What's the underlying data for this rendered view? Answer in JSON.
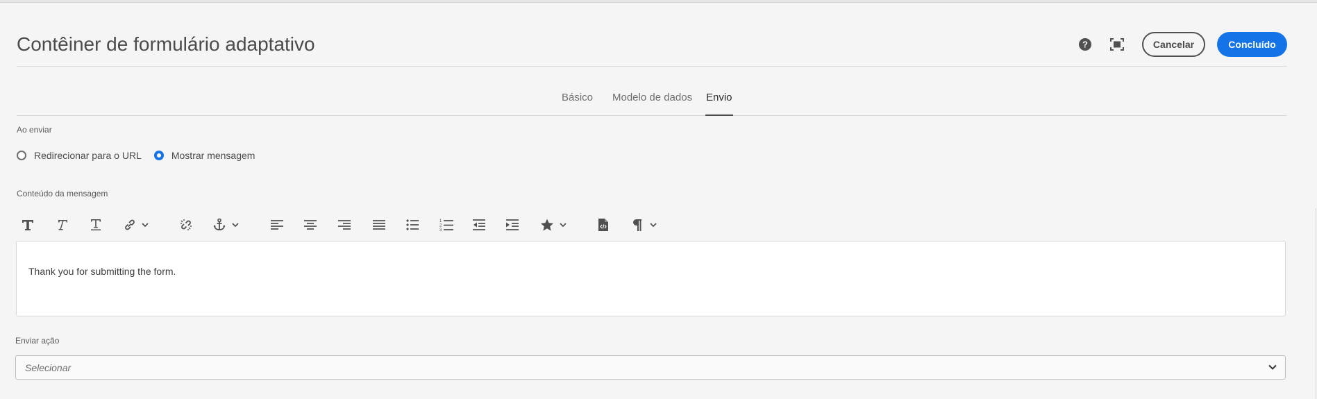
{
  "header": {
    "title": "Contêiner de formulário adaptativo",
    "help_icon": "help-icon",
    "fullscreen_icon": "fullscreen-icon",
    "cancel_label": "Cancelar",
    "done_label": "Concluído"
  },
  "tabs": [
    {
      "label": "Básico",
      "active": false
    },
    {
      "label": "Modelo de dados",
      "active": false
    },
    {
      "label": "Envio",
      "active": true
    }
  ],
  "submit": {
    "on_submit_label": "Ao enviar",
    "options": [
      {
        "label": "Redirecionar para o URL",
        "checked": false
      },
      {
        "label": "Mostrar mensagem",
        "checked": true
      }
    ],
    "message_label": "Conteúdo da mensagem",
    "message_text": "Thank you for submitting the form.",
    "action_label": "Enviar ação",
    "action_placeholder": "Selecionar"
  },
  "toolbar": {
    "icons": [
      "bold-icon",
      "italic-icon",
      "underline-icon",
      "link-icon",
      "unlink-icon",
      "anchor-icon",
      "align-left-icon",
      "align-center-icon",
      "align-right-icon",
      "justify-icon",
      "bullet-list-icon",
      "numbered-list-icon",
      "outdent-icon",
      "indent-icon",
      "special-char-icon",
      "source-edit-icon",
      "paragraph-format-icon"
    ]
  },
  "colors": {
    "accent": "#1473e6",
    "background": "#f5f5f5"
  }
}
